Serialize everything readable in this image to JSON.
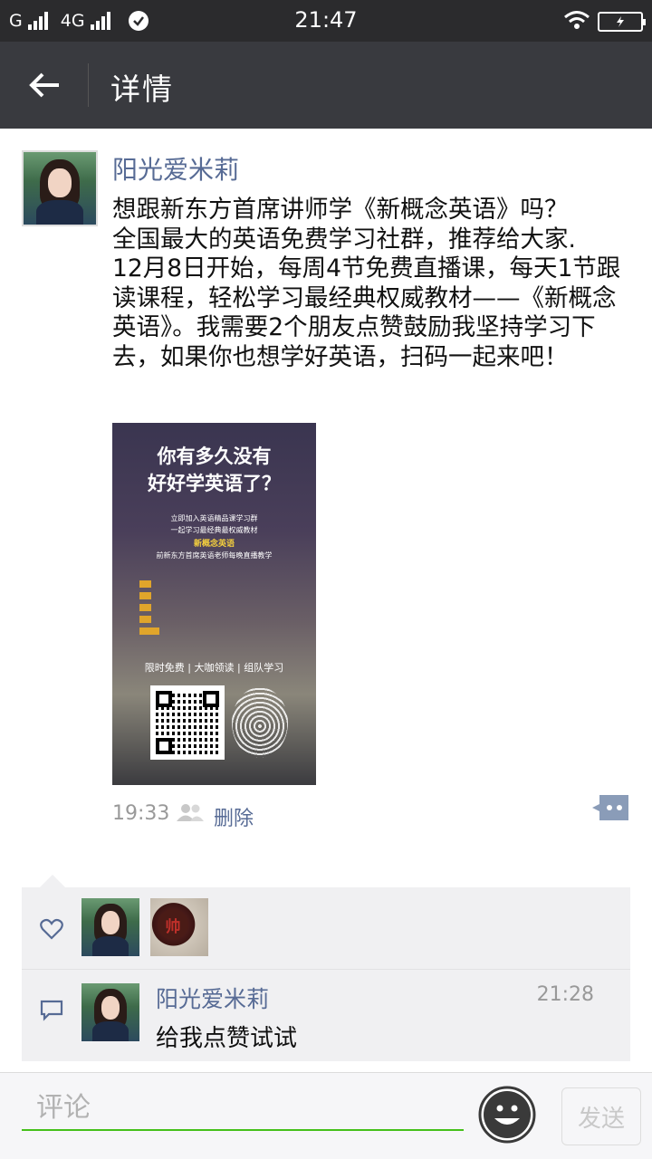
{
  "status_bar": {
    "carrier1": "G",
    "carrier2": "4G",
    "time": "21:47"
  },
  "header": {
    "title": "详情"
  },
  "post": {
    "author": "阳光爱米莉",
    "text": "想跟新东方首席讲师学《新概念英语》吗？\n全国最大的英语免费学习社群，推荐给大家.\n12月8日开始，每周4节免费直播课，每天1节跟读课程，轻松学习最经典权威教材——《新概念英语》。我需要2个朋友点赞鼓励我坚持学习下去，如果你也想学好英语，扫码一起来吧！",
    "poster": {
      "headline1": "你有多久没有",
      "headline2": "好好学英语了？",
      "line1": "立即加入英语精品课学习群",
      "line2": "一起学习最经典最权威教材",
      "highlight": "新概念英语",
      "line3": "前新东方首席英语老师每晚直播教学",
      "band": "限时免费 | 大咖领读 | 组队学习"
    },
    "time": "19:33",
    "delete_label": "删除"
  },
  "likes": {
    "avatar2_char": "帅"
  },
  "comments": [
    {
      "author": "阳光爱米莉",
      "time": "21:28",
      "text": "给我点赞试试"
    }
  ],
  "input_bar": {
    "placeholder": "评论",
    "send_label": "发送"
  },
  "colors": {
    "link": "#576b95",
    "accent_green": "#45c01a",
    "header_bg": "#393a3f"
  }
}
